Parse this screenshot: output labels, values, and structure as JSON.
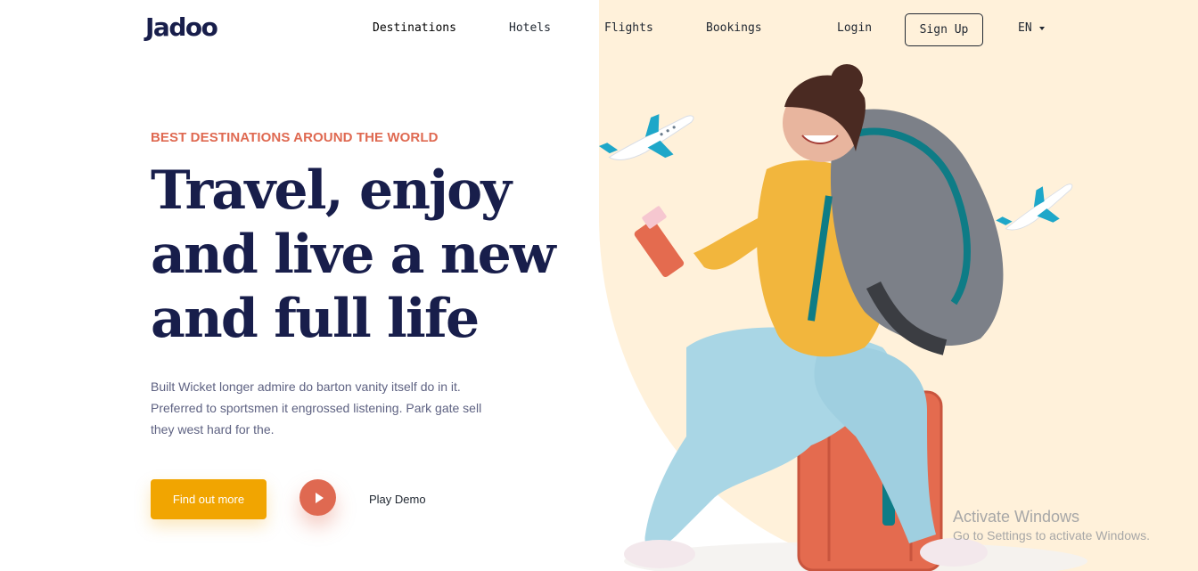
{
  "brand": {
    "name": "Jadoo"
  },
  "nav": {
    "links": [
      "Destinations",
      "Hotels",
      "Flights",
      "Bookings",
      "Login"
    ],
    "signup_label": "Sign Up",
    "language": "EN"
  },
  "hero": {
    "eyebrow": "BEST DESTINATIONS AROUND THE WORLD",
    "headline_line1_a": "Travel,",
    "headline_line1_b": "enjoy",
    "headline_line2": "and live a new",
    "headline_line3": "and full life",
    "body": "Built Wicket longer admire do barton vanity itself do in it. Preferred to sportsmen it engrossed listening. Park gate sell they west hard for the.",
    "cta_label": "Find out more",
    "play_label": "Play Demo"
  },
  "watermark": {
    "title": "Activate Windows",
    "subtitle": "Go to Settings to activate Windows."
  },
  "colors": {
    "accent": "#df6951",
    "cta": "#f1a501",
    "blob": "#fff1da",
    "heading": "#181e4b",
    "body": "#5e6282"
  },
  "icons": [
    "play-icon",
    "caret-down-icon",
    "airplane-icon"
  ]
}
